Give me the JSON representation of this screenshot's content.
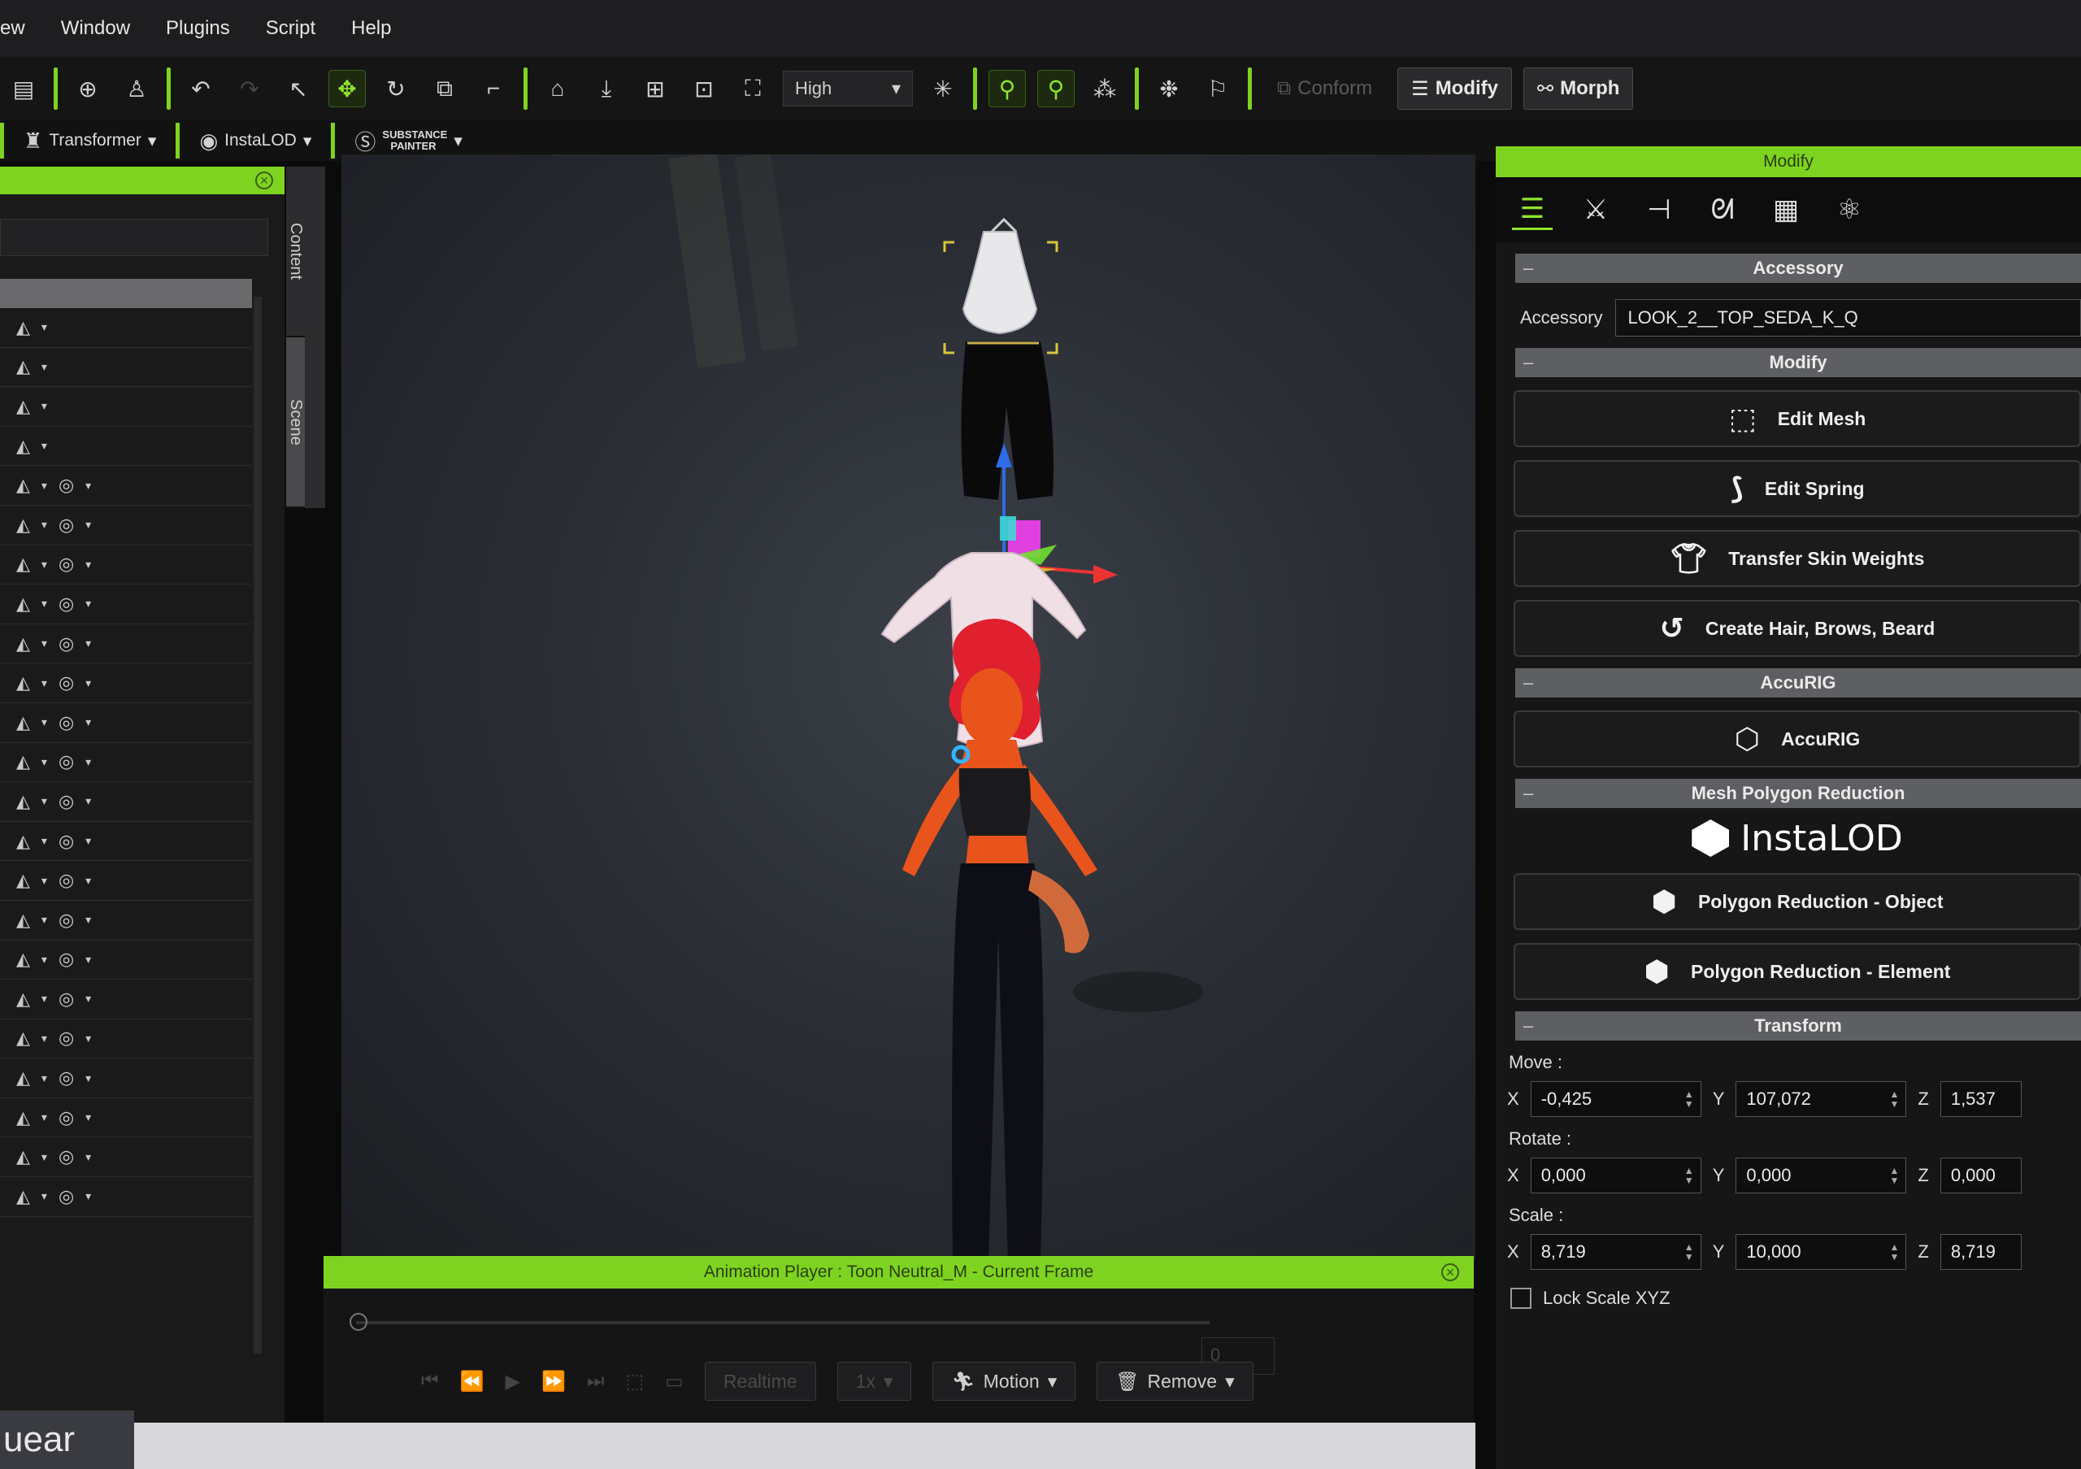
{
  "menu": [
    "ew",
    "Window",
    "Plugins",
    "Script",
    "Help"
  ],
  "toolbar": {
    "quality": "High",
    "conform": "Conform",
    "modify": "Modify",
    "morph": "Morph"
  },
  "toolbar2": {
    "transformer": "Transformer",
    "instalod": "InstaLOD",
    "substance_top": "SUBSTANCE",
    "substance_bottom": "PAINTER"
  },
  "side_tabs": [
    "Content",
    "Scene"
  ],
  "left_rows": 23,
  "animation_player": {
    "title": "Animation Player : Toon Neutral_M - Current Frame",
    "frame": "0",
    "realtime": "Realtime",
    "speed": "1x",
    "motion": "Motion",
    "remove": "Remove"
  },
  "modify_panel": {
    "title": "Modify",
    "accessory_section": "Accessory",
    "accessory_label": "Accessory",
    "accessory_value": "LOOK_2__TOP_SEDA_K_Q",
    "modify_section": "Modify",
    "edit_mesh": "Edit Mesh",
    "edit_spring": "Edit Spring",
    "transfer_skin": "Transfer Skin Weights",
    "create_hair": "Create Hair, Brows, Beard",
    "accurig_section": "AccuRIG",
    "accurig_button": "AccuRIG",
    "mesh_reduction_section": "Mesh Polygon Reduction",
    "instalod_logo": "InstaLOD",
    "poly_object": "Polygon Reduction - Object",
    "poly_element": "Polygon Reduction - Element",
    "transform_section": "Transform",
    "move_label": "Move :",
    "rotate_label": "Rotate :",
    "scale_label": "Scale :",
    "move": {
      "x": "-0,425",
      "y": "107,072",
      "z": "1,537"
    },
    "rotate": {
      "x": "0,000",
      "y": "0,000",
      "z": "0,000"
    },
    "scale": {
      "x": "8,719",
      "y": "10,000",
      "z": "8,719"
    },
    "lock_scale": "Lock Scale XYZ"
  },
  "bottom_label": "uear"
}
